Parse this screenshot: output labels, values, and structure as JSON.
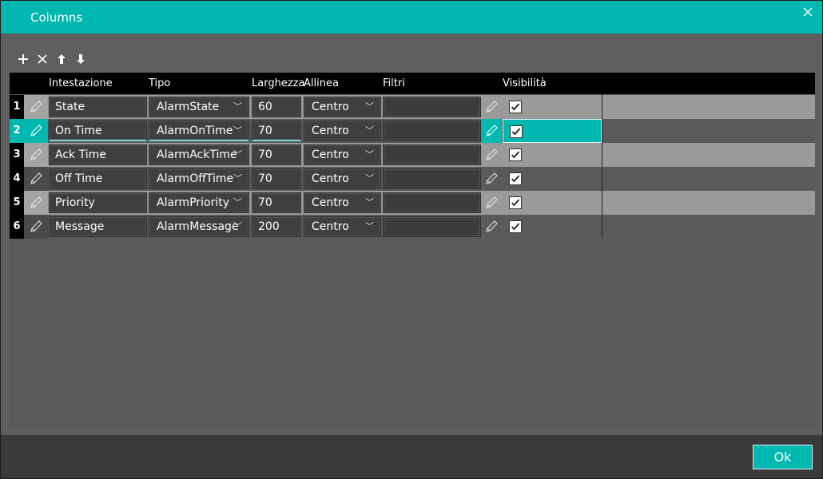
{
  "dialog": {
    "title": "Columns",
    "ok_label": "Ok"
  },
  "toolbar": {
    "icons": [
      "plus-icon",
      "x-icon",
      "arrow-up-icon",
      "arrow-down-icon"
    ]
  },
  "grid": {
    "headers": [
      "Intestazione",
      "Tipo",
      "Larghezza",
      "Allinea",
      "Filtri",
      "Visibilità"
    ],
    "rows": [
      {
        "num": "1",
        "header": "State",
        "type": "AlarmState",
        "width": "60",
        "align": "Centro",
        "filter": "",
        "visible": true
      },
      {
        "num": "2",
        "header": "On Time",
        "type": "AlarmOnTime",
        "width": "70",
        "align": "Centro",
        "filter": "",
        "visible": true,
        "selected": true
      },
      {
        "num": "3",
        "header": "Ack Time",
        "type": "AlarmAckTime",
        "width": "70",
        "align": "Centro",
        "filter": "",
        "visible": true
      },
      {
        "num": "4",
        "header": "Off Time",
        "type": "AlarmOffTime",
        "width": "70",
        "align": "Centro",
        "filter": "",
        "visible": true
      },
      {
        "num": "5",
        "header": "Priority",
        "type": "AlarmPriority",
        "width": "70",
        "align": "Centro",
        "filter": "",
        "visible": true
      },
      {
        "num": "6",
        "header": "Message",
        "type": "AlarmMessage",
        "width": "200",
        "align": "Centro",
        "filter": "",
        "visible": true
      }
    ]
  },
  "colors": {
    "accent": "#00b8b0",
    "panel": "#5e5e5e",
    "row_light": "#9a9a9a",
    "row_dark": "#5a5a5a"
  }
}
